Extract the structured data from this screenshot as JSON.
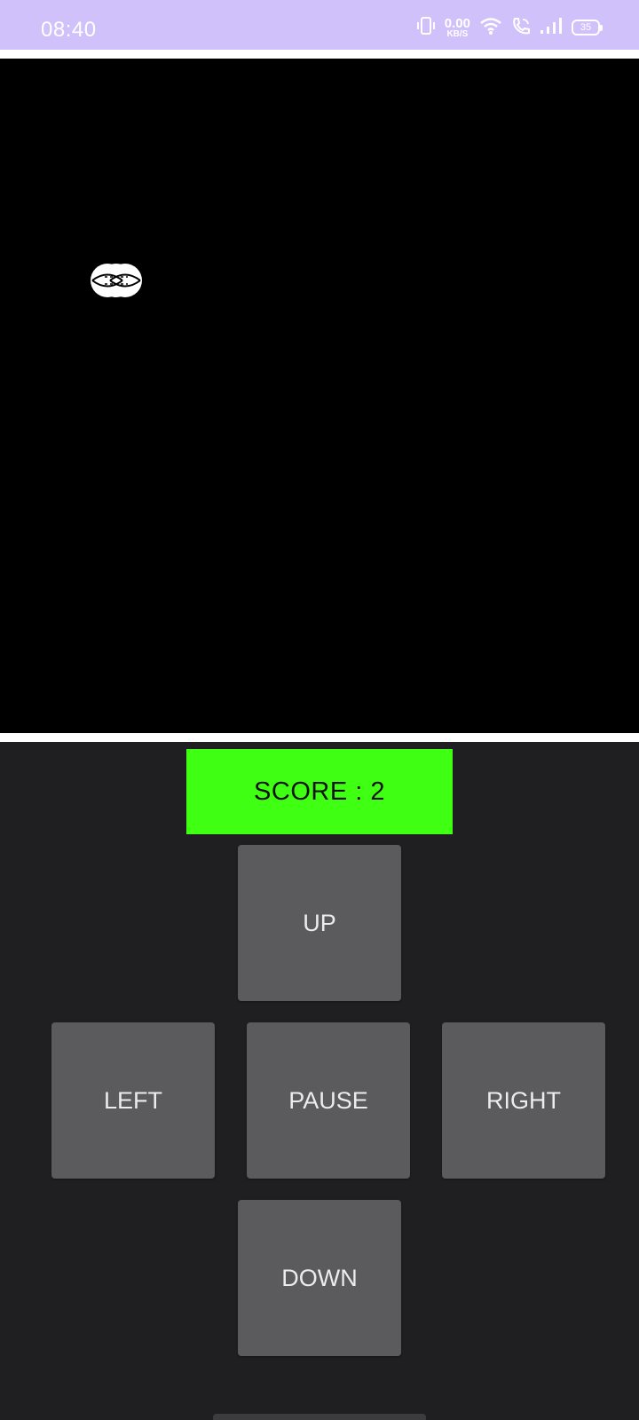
{
  "status_bar": {
    "time": "08:40",
    "speed_value": "0.00",
    "speed_unit": "KB/S",
    "battery": "35",
    "icons": [
      "vibrate-icon",
      "wifi-icon",
      "wifi-calling-icon",
      "signal-icon",
      "battery-icon"
    ],
    "background": "#d0c1fb"
  },
  "game": {
    "board_color": "#000000",
    "snake_color": "#ffffff"
  },
  "controls": {
    "score_text": "SCORE : 2",
    "score_color": "#3fff12",
    "buttons": {
      "up": "UP",
      "left": "LEFT",
      "pause": "PAUSE",
      "right": "RIGHT",
      "down": "DOWN"
    },
    "button_color": "#5b5b5d"
  }
}
